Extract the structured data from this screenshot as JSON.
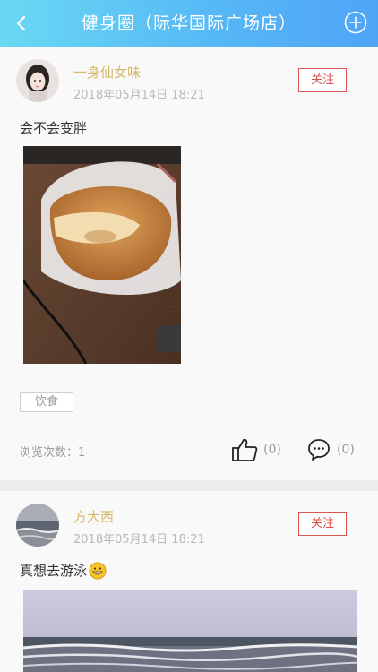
{
  "header": {
    "title": "健身圈（际华国际广场店）"
  },
  "posts": [
    {
      "username": "一身仙女味",
      "time": "2018年05月14日 18:21",
      "follow_label": "关注",
      "content": "会不会变胖",
      "tag": "饮食",
      "views": "浏览次数：1",
      "likes": "(0)",
      "comments": "(0)"
    },
    {
      "username": "方大西",
      "time": "2018年05月14日 18:21",
      "follow_label": "关注",
      "content": "真想去游泳"
    }
  ],
  "colors": {
    "accent": "#55b6f6",
    "name": "#d9b86b",
    "follow": "#d9534f"
  }
}
